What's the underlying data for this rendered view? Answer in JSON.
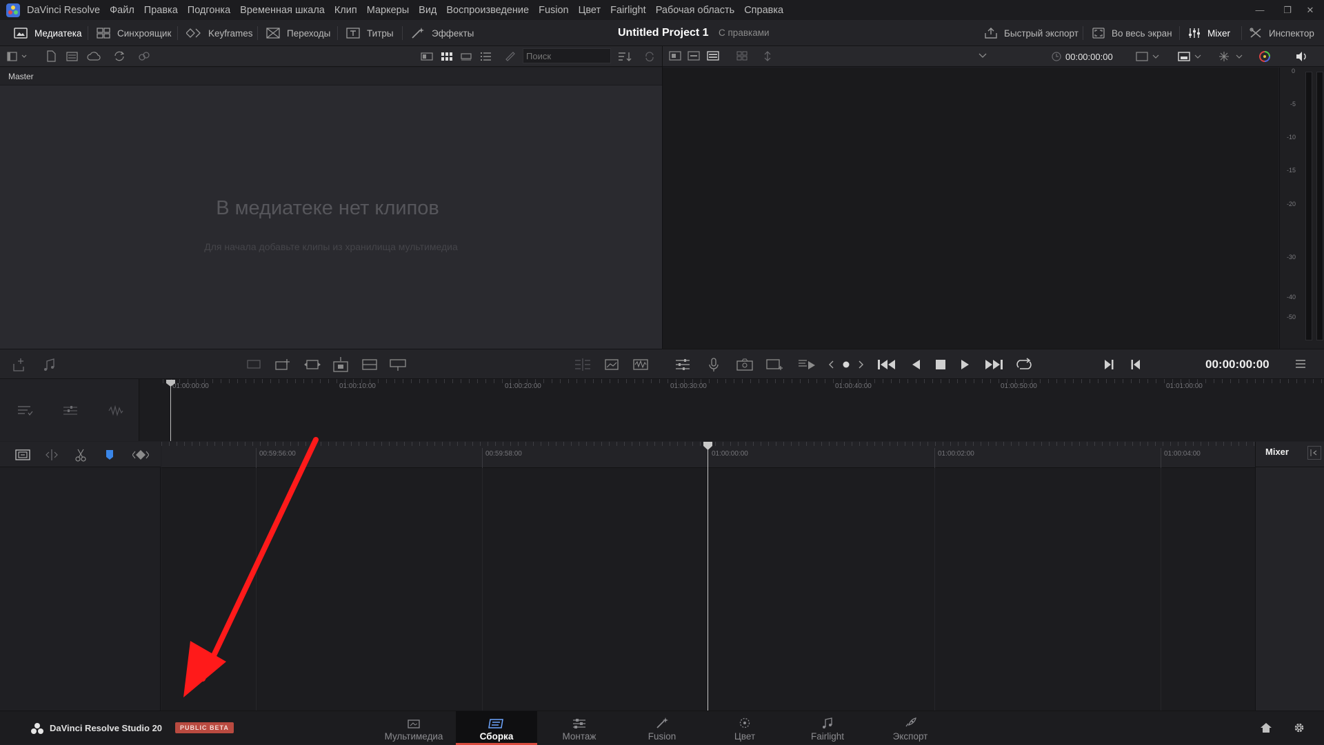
{
  "app": {
    "title": "DaVinci Resolve",
    "menu": [
      "Файл",
      "Правка",
      "Подгонка",
      "Временная шкала",
      "Клип",
      "Маркеры",
      "Вид",
      "Воспроизведение",
      "Fusion",
      "Цвет",
      "Fairlight",
      "Рабочая область",
      "Справка"
    ]
  },
  "toolbar": {
    "left_buttons": [
      {
        "label": "Медиатека",
        "icon": "media-pool-icon",
        "active": true
      },
      {
        "label": "Синхроящик",
        "icon": "sync-bin-icon"
      },
      {
        "label": "Keyframes",
        "icon": "keyframes-icon"
      },
      {
        "label": "Переходы",
        "icon": "transitions-icon"
      },
      {
        "label": "Титры",
        "icon": "titles-icon"
      },
      {
        "label": "Эффекты",
        "icon": "effects-icon"
      }
    ],
    "project_title": "Untitled Project 1",
    "project_status": "С правками",
    "right_buttons": [
      {
        "label": "Быстрый экспорт",
        "icon": "quick-export-icon"
      },
      {
        "label": "Во весь экран",
        "icon": "fullscreen-icon"
      },
      {
        "label": "Mixer",
        "icon": "mixer-icon",
        "active": true
      },
      {
        "label": "Инспектор",
        "icon": "inspector-icon"
      }
    ]
  },
  "subbar": {
    "search_placeholder": "Поиск",
    "viewer_timecode": "00:00:00:00"
  },
  "media_pool": {
    "bin": "Master",
    "empty_title": "В медиатеке нет клипов",
    "empty_hint": "Для начала добавьте клипы из хранилища мультимедиа"
  },
  "meter": {
    "labels": [
      "0",
      "-5",
      "-10",
      "-15",
      "-20",
      "-30",
      "-40",
      "-50"
    ]
  },
  "transport": {
    "timecode": "00:00:00:00"
  },
  "mini_timeline": {
    "ruler": [
      "01:00:00:00",
      "01:00:10:00",
      "01:00:20:00",
      "01:00:30:00",
      "01:00:40:00",
      "01:00:50:00",
      "01:01:00:00"
    ]
  },
  "timeline": {
    "ruler": [
      "00:59:56:00",
      "00:59:58:00",
      "01:00:00:00",
      "01:00:02:00",
      "01:00:04:00"
    ],
    "mixer_label": "Mixer"
  },
  "pagebar": {
    "brand": "DaVinci Resolve Studio 20",
    "badge": "PUBLIC BETA",
    "pages": [
      {
        "label": "Мультимедиа",
        "icon": "media-page-icon"
      },
      {
        "label": "Сборка",
        "icon": "cut-page-icon",
        "active": true
      },
      {
        "label": "Монтаж",
        "icon": "edit-page-icon"
      },
      {
        "label": "Fusion",
        "icon": "fusion-page-icon"
      },
      {
        "label": "Цвет",
        "icon": "color-page-icon"
      },
      {
        "label": "Fairlight",
        "icon": "fairlight-page-icon"
      },
      {
        "label": "Экспорт",
        "icon": "deliver-page-icon"
      }
    ]
  },
  "colors": {
    "accent_red": "#d84b3e",
    "annotation_arrow": "#ff1a1a",
    "badge_bg": "#b94a40"
  }
}
